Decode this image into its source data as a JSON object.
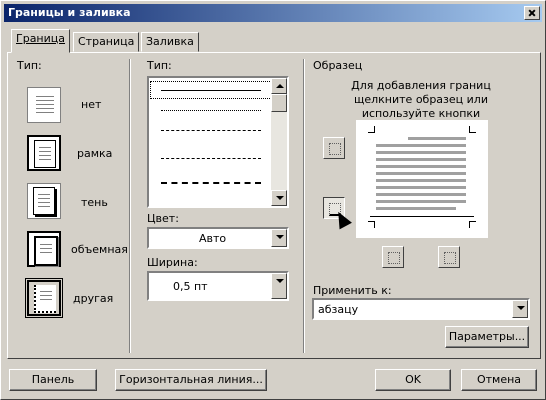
{
  "window": {
    "title": "Границы и заливка"
  },
  "tabs": [
    {
      "label": "Граница",
      "active": true
    },
    {
      "label": "Страница",
      "active": false
    },
    {
      "label": "Заливка",
      "active": false
    }
  ],
  "type_section": {
    "label": "Тип:",
    "presets": [
      {
        "label": "нет",
        "icon": "border-none-icon"
      },
      {
        "label": "рамка",
        "icon": "border-box-icon"
      },
      {
        "label": "тень",
        "icon": "border-shadow-icon"
      },
      {
        "label": "объемная",
        "icon": "border-3d-icon"
      },
      {
        "label": "другая",
        "icon": "border-custom-icon",
        "selected": true
      }
    ]
  },
  "style_section": {
    "label": "Тип:",
    "line_styles": [
      "solid",
      "dotted",
      "dashed",
      "long-dash",
      "dash-dot"
    ],
    "selected_index": 0,
    "color_label": "Цвет:",
    "color_value": "Авто",
    "width_label": "Ширина:",
    "width_value": "0,5 пт"
  },
  "preview_section": {
    "label": "Образец",
    "hint": "Для добавления границ щелкните образец или используйте кнопки",
    "apply_label": "Применить к:",
    "apply_value": "абзацу",
    "options_button": "Параметры..."
  },
  "footer": {
    "panel_button": "Панель",
    "hline_button": "Горизонтальная линия...",
    "ok_button": "OK",
    "cancel_button": "Отмена"
  }
}
